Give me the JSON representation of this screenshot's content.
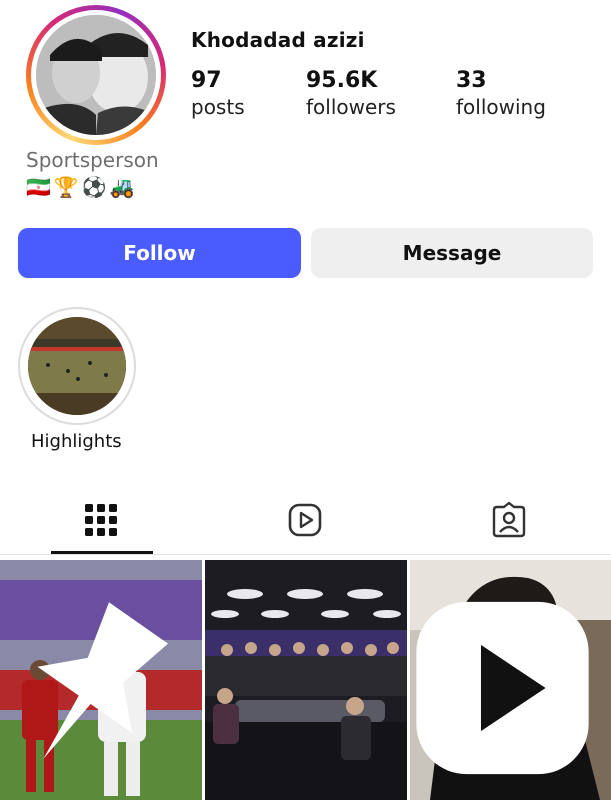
{
  "profile": {
    "name": "Khodadad azizi",
    "category": "Sportsperson",
    "bio_emojis": [
      "🇮🇷",
      "🏆",
      "⚽",
      "🚜"
    ]
  },
  "stats": {
    "posts": {
      "value": "97",
      "label": "posts"
    },
    "followers": {
      "value": "95.6K",
      "label": "followers"
    },
    "following": {
      "value": "33",
      "label": "following"
    }
  },
  "actions": {
    "follow_label": "Follow",
    "message_label": "Message"
  },
  "highlights": [
    {
      "label": "Highlights"
    }
  ],
  "tabs": [
    {
      "icon": "grid-icon",
      "active": true
    },
    {
      "icon": "reels-icon",
      "active": false
    },
    {
      "icon": "tagged-icon",
      "active": false
    }
  ],
  "posts": [
    {
      "overlay": "pin-icon"
    },
    {
      "overlay": ""
    },
    {
      "overlay": "reel-icon"
    }
  ],
  "colors": {
    "follow_button": "#4a5cff",
    "message_button": "#efefef",
    "category_text": "#6e6e6e"
  }
}
